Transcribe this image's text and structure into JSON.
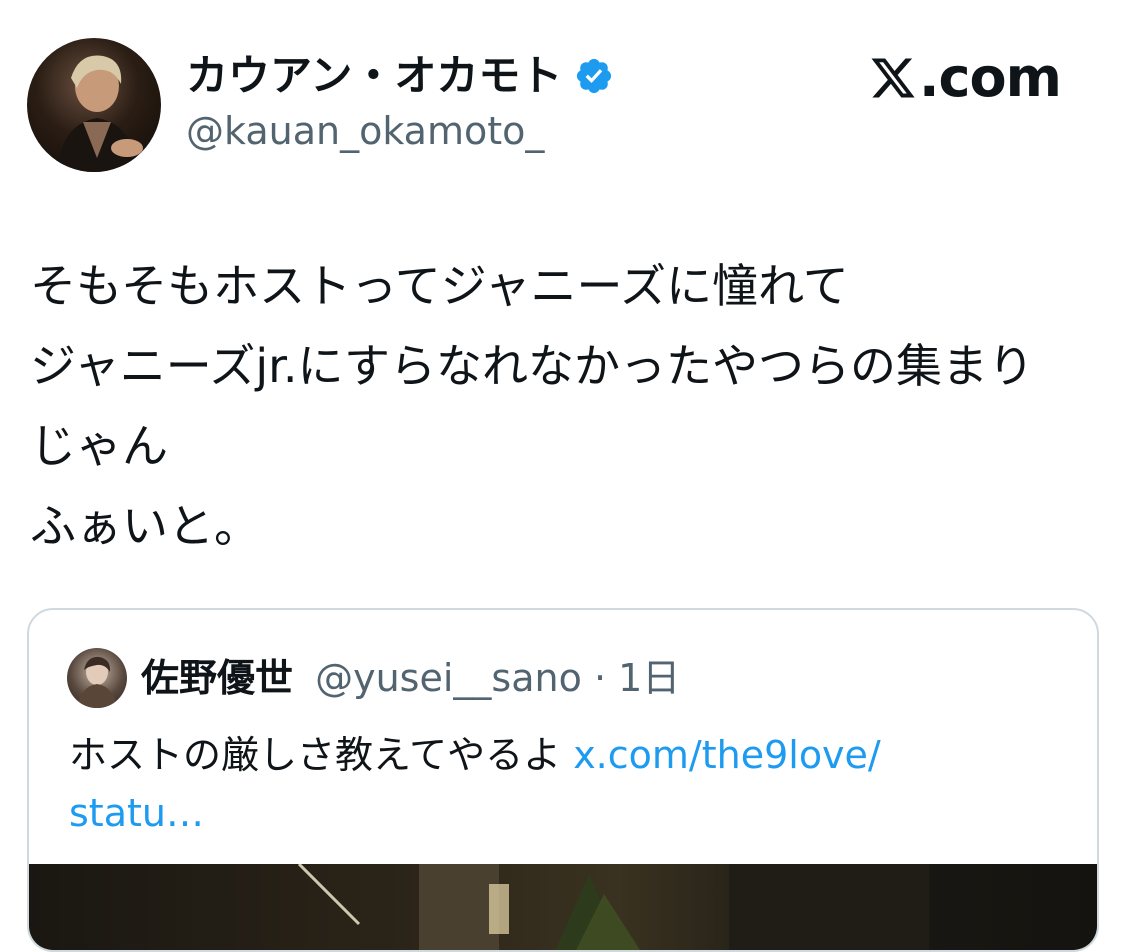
{
  "author": {
    "display_name": "カウアン・オカモト",
    "handle": "@kauan_okamoto_",
    "verified": true,
    "verified_icon": "verified-badge-icon",
    "verified_color": "#1d9bf0"
  },
  "brand": {
    "icon": "x-logo-icon",
    "text": ".com"
  },
  "tweet": {
    "lines": [
      "そもそもホストってジャニーズに憧れて",
      "ジャニーズjr.にすらなれなかったやつらの集まり",
      "じゃん",
      "ふぁいと。"
    ]
  },
  "quote": {
    "name": "佐野優世",
    "handle": "@yusei__sano",
    "separator": "·",
    "time": "1日",
    "text": "ホストの厳しさ教えてやるよ ",
    "link_text": "x.com/the9love/",
    "link_text_2": "statu…"
  },
  "colors": {
    "text": "#0f1419",
    "secondary": "#536471",
    "link": "#1d9bf0",
    "border": "#cfd9de"
  }
}
